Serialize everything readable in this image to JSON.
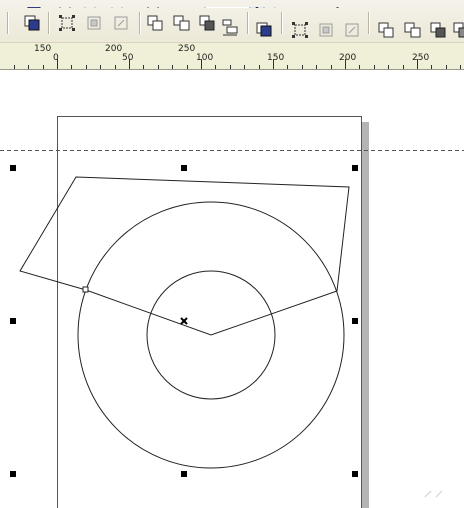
{
  "toolbar": {
    "icons": [
      "arrange-front-icon",
      "align-distribute-icon",
      "group-icon",
      "ungroup-icon",
      "weld-icon",
      "trim-icon",
      "intersect-icon",
      "simplify-icon",
      "to-front-icon",
      "align-icon",
      "group-icon-2",
      "ungroup-icon-2",
      "weld-icon-2",
      "trim-icon-2",
      "intersect-icon-2",
      "back-minus-front-icon"
    ],
    "colors": {
      "face": "#ece9d8",
      "ruler": "#f0f0d8",
      "shadow": "#b0b0b0"
    }
  },
  "ruler": {
    "labels": [
      "150",
      "200",
      "250",
      "0",
      "50",
      "100",
      "150",
      "200",
      "250"
    ]
  },
  "canvas": {
    "page_shadow_color": "#b4b4b4",
    "guideline_style": "dashed",
    "selection_handles": 6,
    "center_marker": "×"
  }
}
